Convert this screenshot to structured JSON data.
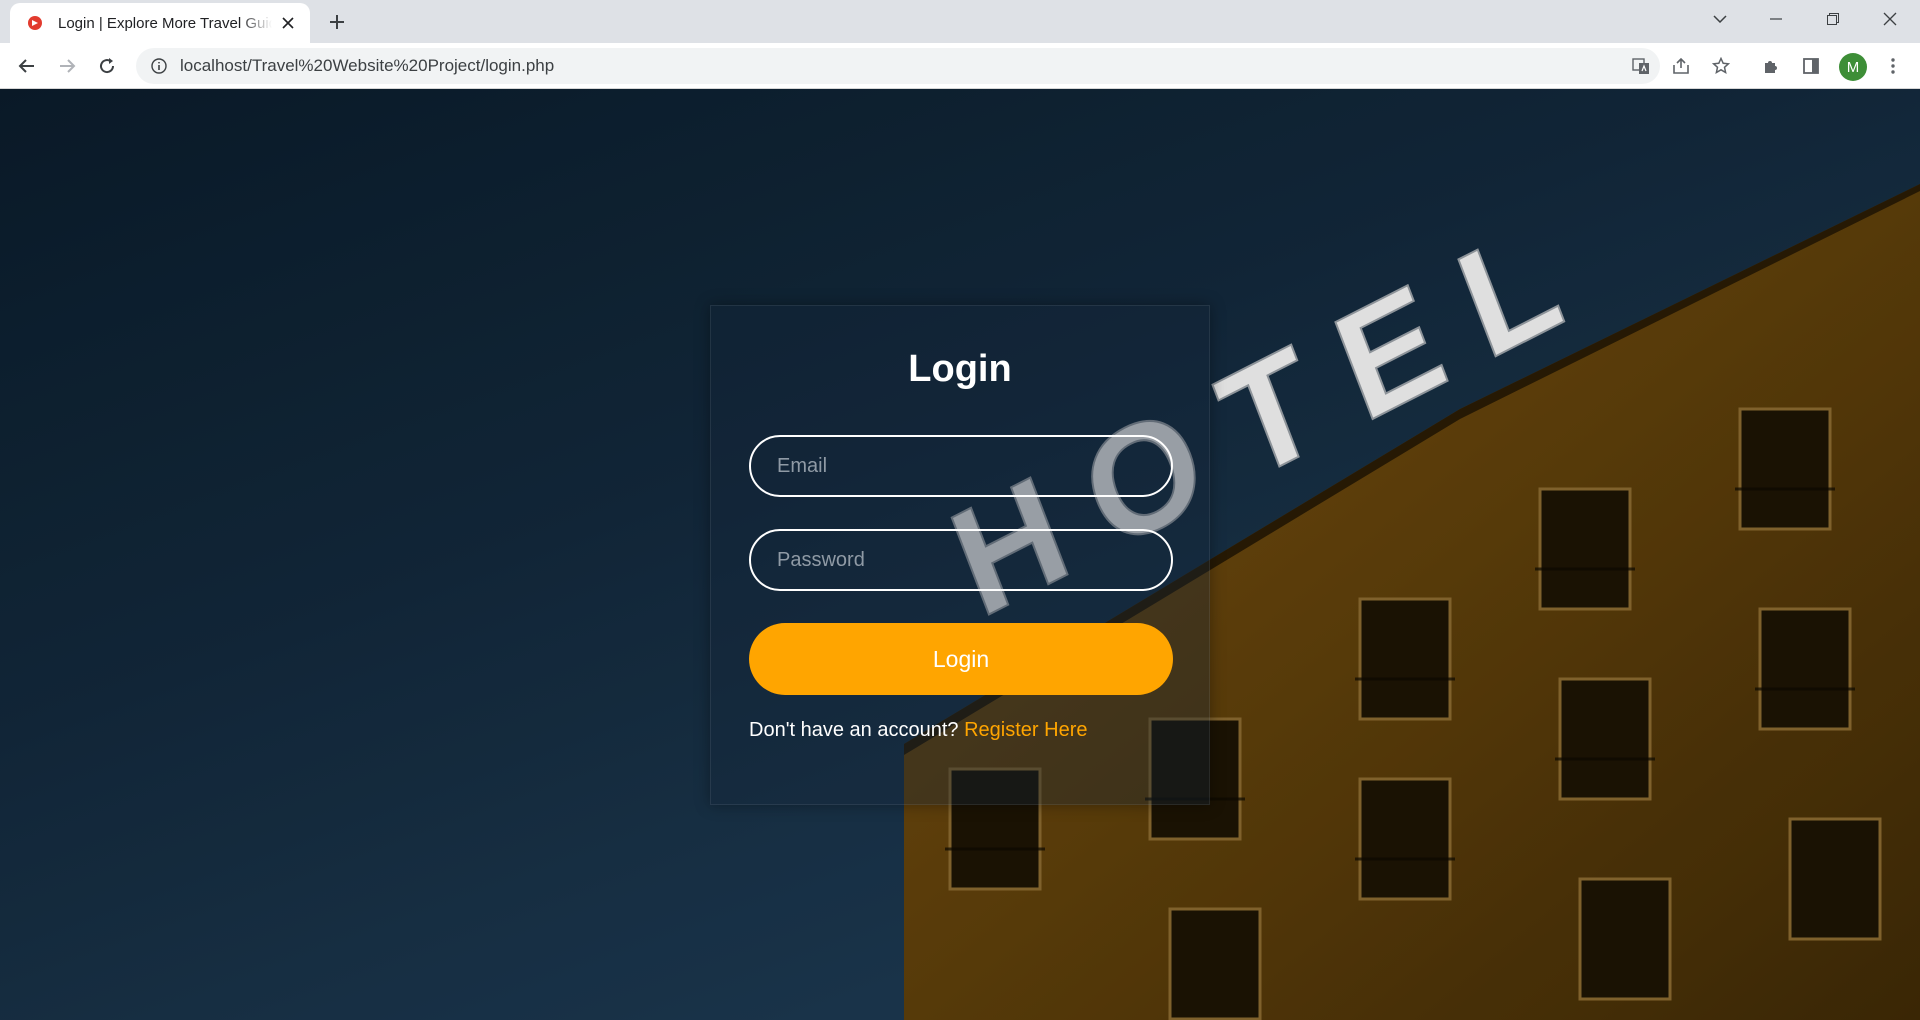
{
  "browser": {
    "tab_title": "Login | Explore More Travel Guide",
    "url": "localhost/Travel%20Website%20Project/login.php",
    "profile_initial": "M",
    "accent_color": "#3d8e37"
  },
  "icons": {
    "favicon": "travel-site-favicon",
    "tab_close": "close-icon",
    "new_tab": "plus-icon",
    "tab_search": "chevron-down-icon",
    "minimize": "minimize-icon",
    "restore": "restore-icon",
    "close_window": "close-icon",
    "back": "arrow-left-icon",
    "forward": "arrow-right-icon",
    "reload": "reload-icon",
    "site_info": "info-icon",
    "translate": "translate-icon",
    "share": "share-icon",
    "bookmark": "star-icon",
    "extensions": "puzzle-icon",
    "side_panel": "side-panel-icon",
    "menu": "kebab-menu-icon"
  },
  "background": {
    "sign_text": "HOTEL"
  },
  "login_form": {
    "title": "Login",
    "email_placeholder": "Email",
    "password_placeholder": "Password",
    "submit_label": "Login",
    "register_prompt": "Don't have an account?",
    "register_link": "Register Here",
    "accent_color": "#ffa500"
  }
}
